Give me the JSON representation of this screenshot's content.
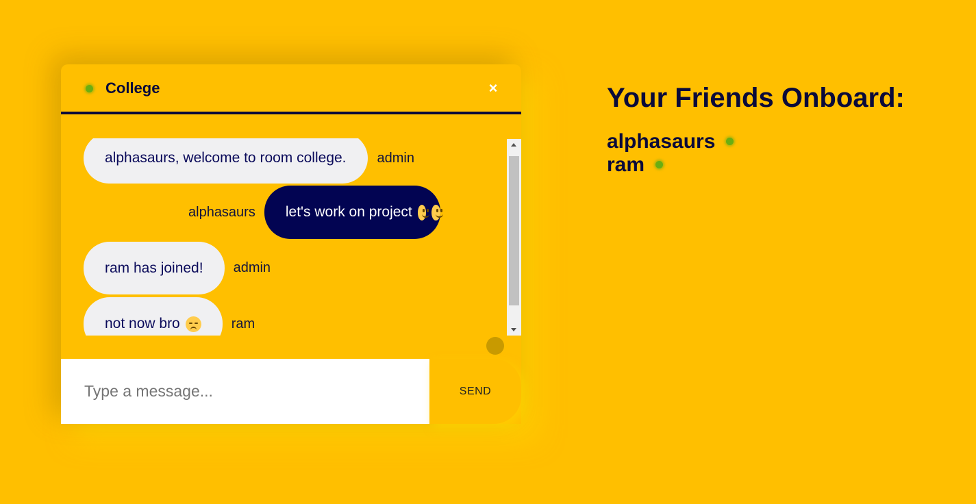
{
  "colors": {
    "background": "#FFBF00",
    "dark_navy": "#0A0A3A",
    "outgoing_bubble": "#020452",
    "incoming_bubble": "#F0F0F2",
    "online_dot": "#6AAE12"
  },
  "chat": {
    "room_name": "College",
    "close_label": "×",
    "messages": [
      {
        "text": "alphasaurs, welcome to room college.",
        "sender": "admin",
        "direction": "incoming",
        "emojis": []
      },
      {
        "text": "let's work on project",
        "sender": "alphasaurs",
        "direction": "outgoing",
        "emojis": [
          "slightly-smiling-face",
          "slightly-smiling-face"
        ]
      },
      {
        "text": "ram has joined!",
        "sender": "admin",
        "direction": "incoming",
        "emojis": []
      },
      {
        "text": "not now bro",
        "sender": "ram",
        "direction": "incoming",
        "emojis": [
          "pensive-face"
        ]
      }
    ],
    "input_placeholder": "Type a message...",
    "input_value": "",
    "send_label": "SEND"
  },
  "friends": {
    "title": "Your Friends Onboard:",
    "list": [
      {
        "name": "alphasaurs",
        "status": "online"
      },
      {
        "name": "ram",
        "status": "online"
      }
    ]
  }
}
